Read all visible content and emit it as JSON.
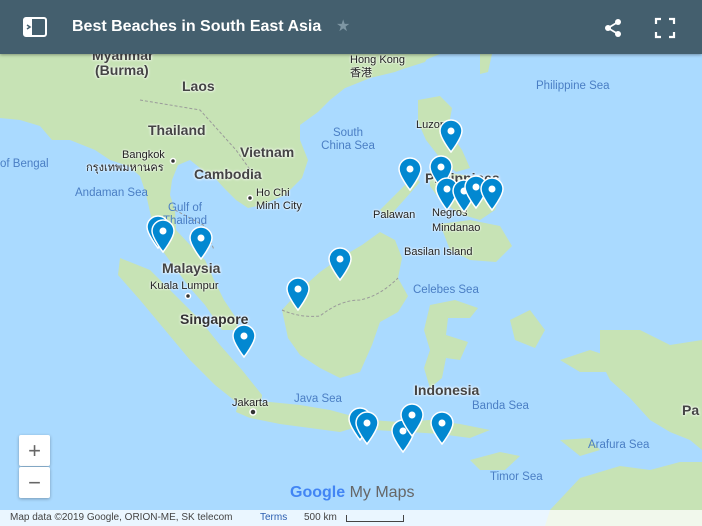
{
  "header": {
    "title": "Best Beaches in South East Asia"
  },
  "labels": {
    "countries": {
      "myanmar": "Myanmar",
      "burma": "(Burma)",
      "laos": "Laos",
      "thailand": "Thailand",
      "vietnam": "Vietnam",
      "cambodia": "Cambodia",
      "malaysia": "Malaysia",
      "philippines": "Philippines",
      "indonesia": "Indonesia",
      "singapore": "Singapore",
      "papua": "Pa"
    },
    "cities": {
      "hongkong": "Hong Kong",
      "hongkong_cn": "香港",
      "bangkok": "Bangkok",
      "bangkok_th": "กรุงเทพมหานคร",
      "hochiminh": "Ho Chi Minh City",
      "kualalumpur": "Kuala Lumpur",
      "jakarta": "Jakarta",
      "luzon": "Luzon",
      "palawan": "Palawan",
      "negros": "Negros",
      "mindanao": "Mindanao",
      "basilan": "Basilan Island"
    },
    "seas": {
      "philippine": "Philippine Sea",
      "southchina": "South China Sea",
      "bengal": "of Bengal",
      "andaman": "Andaman Sea",
      "thailandgulf": "Gulf of Thailand",
      "celebes": "Celebes Sea",
      "java": "Java Sea",
      "banda": "Banda Sea",
      "arafura": "Arafura Sea",
      "timor": "Timor Sea"
    }
  },
  "controls": {
    "zoom_in": "+",
    "zoom_out": "−"
  },
  "branding": {
    "google": "Google",
    "mymaps": "My Maps"
  },
  "footer": {
    "attribution": "Map data ©2019 Google, ORION-ME, SK telecom",
    "terms": "Terms",
    "scale": "500 km"
  },
  "colors": {
    "header": "#445f6e",
    "water": "#aadaff",
    "land": "#c7e3b5",
    "pin": "#0288d1"
  }
}
